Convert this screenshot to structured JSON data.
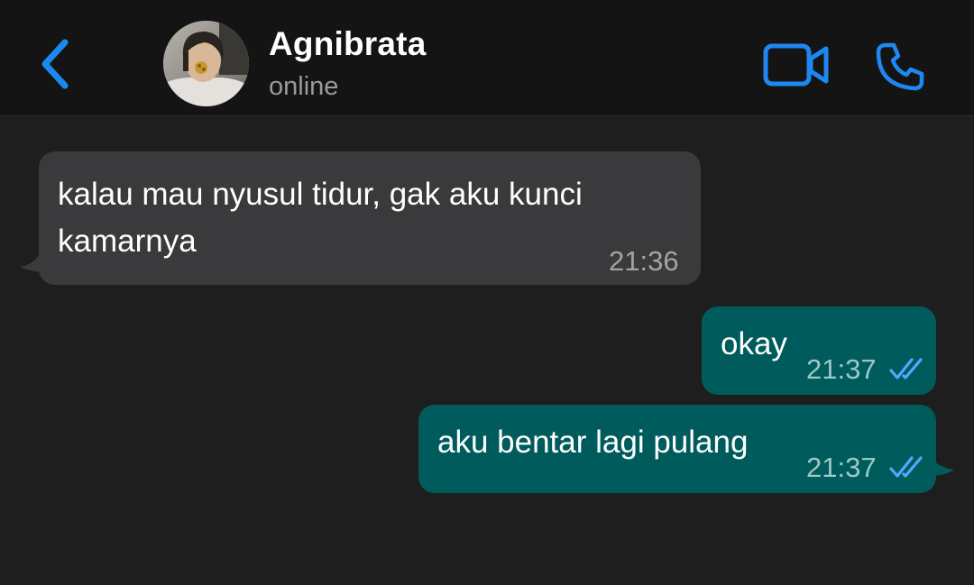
{
  "header": {
    "contact_name": "Agnibrata",
    "status": "online",
    "back_icon": "chevron-left-icon",
    "video_icon": "video-camera-icon",
    "call_icon": "phone-icon",
    "accent_color": "#1e88f2"
  },
  "messages": [
    {
      "direction": "incoming",
      "lines": [
        "kalau mau nyusul tidur, gak aku kunci",
        "kamarnya"
      ],
      "time": "21:36"
    },
    {
      "direction": "outgoing",
      "text": "okay",
      "time": "21:37",
      "status": "read"
    },
    {
      "direction": "outgoing",
      "text": "aku bentar lagi pulang",
      "time": "21:37",
      "status": "read"
    }
  ],
  "colors": {
    "background": "#1e1e1e",
    "header_bg": "#141414",
    "incoming_bubble": "#3a3a3c",
    "outgoing_bubble": "#005c5c",
    "read_ticks": "#4fa8ff"
  }
}
